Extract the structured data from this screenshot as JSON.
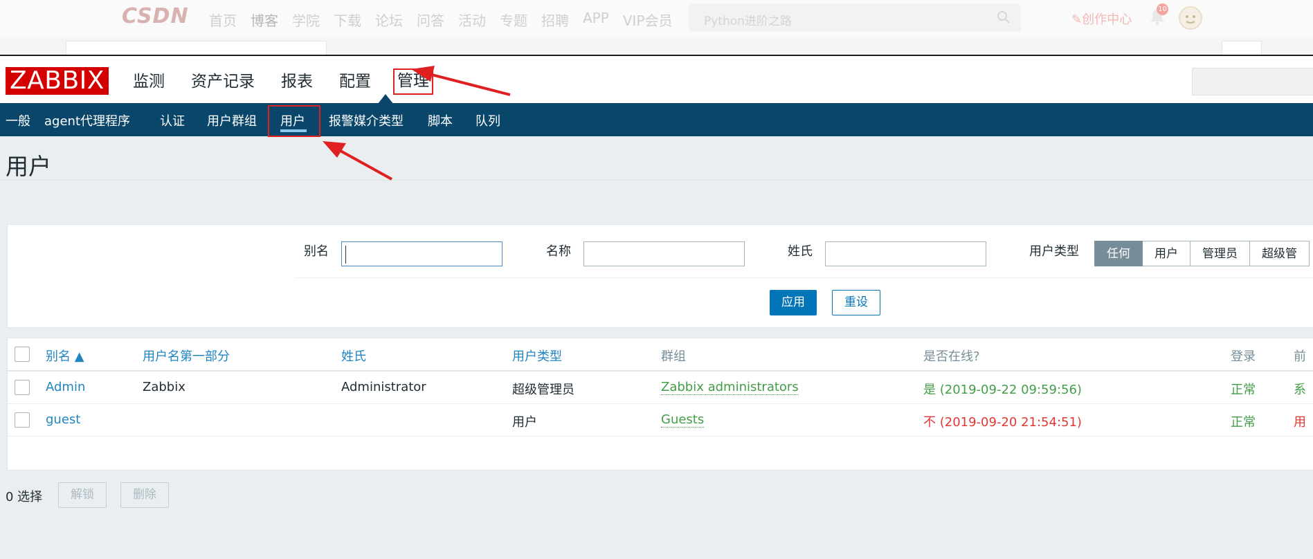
{
  "csdn": {
    "logo": "CSDN",
    "nav": [
      "首页",
      "博客",
      "学院",
      "下载",
      "论坛",
      "问答",
      "活动",
      "专题",
      "招聘",
      "APP",
      "VIP会员"
    ],
    "active_nav": 1,
    "search_placeholder": "Python进阶之路",
    "create_label": "创作中心",
    "notif_count": "10"
  },
  "zabbix": {
    "logo": "ZABBIX",
    "menu": [
      "监测",
      "资产记录",
      "报表",
      "配置",
      "管理"
    ],
    "selected_menu": 4,
    "submenu": [
      "一般",
      "agent代理程序",
      "认证",
      "用户群组",
      "用户",
      "报警媒介类型",
      "脚本",
      "队列"
    ],
    "selected_submenu": 4,
    "page_title": "用户",
    "filter": {
      "alias_label": "别名",
      "alias_value": "",
      "name_label": "名称",
      "name_value": "",
      "surname_label": "姓氏",
      "surname_value": "",
      "user_type_label": "用户类型",
      "user_types": [
        "任何",
        "用户",
        "管理员",
        "超级管"
      ],
      "selected_user_type": 0,
      "apply_label": "应用",
      "reset_label": "重设"
    },
    "table": {
      "columns": [
        "别名 ▲",
        "用户名第一部分",
        "姓氏",
        "用户类型",
        "群组",
        "是否在线?",
        "登录",
        "前"
      ],
      "rows": [
        {
          "alias": "Admin",
          "name": "Zabbix",
          "surname": "Administrator",
          "type": "超级管理员",
          "group": "Zabbix administrators",
          "online": "是 (2019-09-22 09:59:56)",
          "online_status": "yes",
          "login": "正常",
          "frontend": "系"
        },
        {
          "alias": "guest",
          "name": "",
          "surname": "",
          "type": "用户",
          "group": "Guests",
          "online": "不 (2019-09-20 21:54:51)",
          "online_status": "no",
          "login": "正常",
          "frontend": "用"
        }
      ]
    },
    "bottom": {
      "selected_text": "0 选择",
      "unlock_label": "解锁",
      "delete_label": "删除"
    }
  },
  "colors": {
    "zabbix_red": "#d40000",
    "nav_blue": "#0a466a",
    "link_blue": "#1f85c1",
    "green": "#429e47",
    "red": "#e33734",
    "annotation_red": "#e02020"
  }
}
